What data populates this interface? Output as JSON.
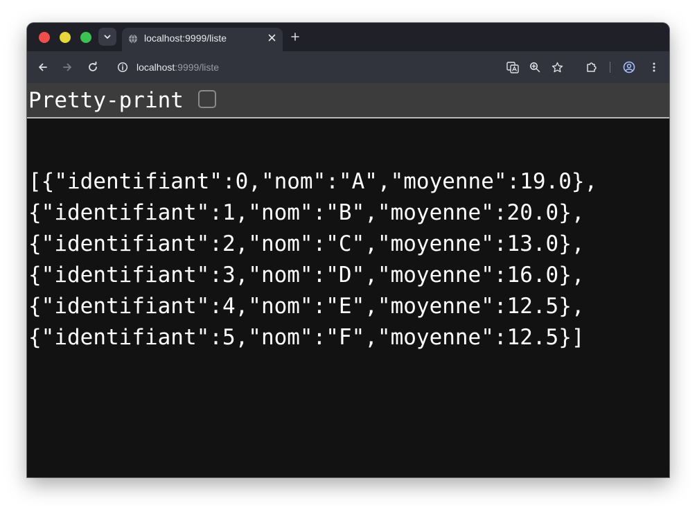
{
  "browser": {
    "tab": {
      "title": "localhost:9999/liste"
    },
    "address_bar": {
      "host": "localhost",
      "path": ":9999/liste"
    },
    "icons": {
      "tab_favicon": "globe-icon",
      "tab_close": "close-icon",
      "new_tab": "plus-icon",
      "back": "arrow-left-icon",
      "forward": "arrow-right-icon",
      "reload": "reload-icon",
      "site_info": "info-icon",
      "translate": "translate-icon",
      "zoom": "zoom-icon",
      "bookmark": "star-icon",
      "extensions": "puzzle-icon",
      "profile": "profile-icon",
      "menu": "kebab-menu-icon"
    },
    "colors": {
      "close": "#ef4e4b",
      "minimize": "#e6d83a",
      "maximize": "#3cc153",
      "page_background": "#121212",
      "pretty_print_bar": "#3c3c3c"
    }
  },
  "page": {
    "pretty_print_label": "Pretty-print",
    "pretty_print_checked": false,
    "json_lines": [
      "[{\"identifiant\":0,\"nom\":\"A\",\"moyenne\":19.0},",
      "{\"identifiant\":1,\"nom\":\"B\",\"moyenne\":20.0},",
      "{\"identifiant\":2,\"nom\":\"C\",\"moyenne\":13.0},",
      "{\"identifiant\":3,\"nom\":\"D\",\"moyenne\":16.0},",
      "{\"identifiant\":4,\"nom\":\"E\",\"moyenne\":12.5},",
      "{\"identifiant\":5,\"nom\":\"F\",\"moyenne\":12.5}]"
    ]
  }
}
